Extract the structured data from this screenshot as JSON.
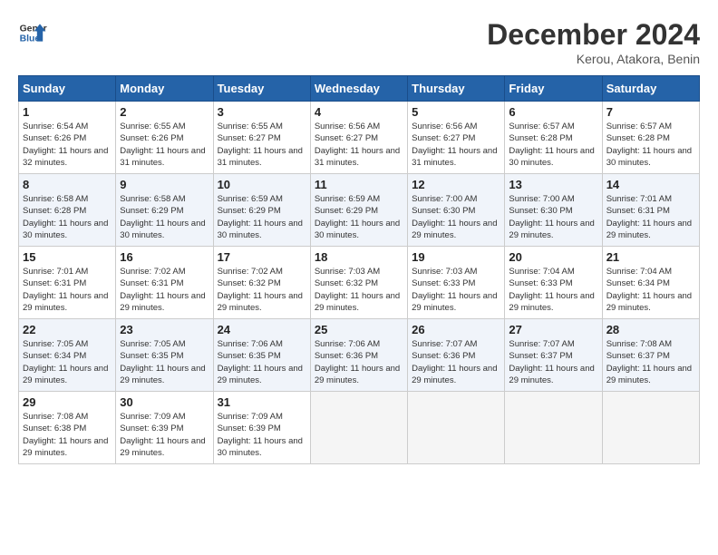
{
  "logo": {
    "line1": "General",
    "line2": "Blue"
  },
  "title": "December 2024",
  "location": "Kerou, Atakora, Benin",
  "days_of_week": [
    "Sunday",
    "Monday",
    "Tuesday",
    "Wednesday",
    "Thursday",
    "Friday",
    "Saturday"
  ],
  "weeks": [
    [
      {
        "day": "1",
        "rise": "6:54 AM",
        "set": "6:26 PM",
        "daylight": "11 hours and 32 minutes."
      },
      {
        "day": "2",
        "rise": "6:55 AM",
        "set": "6:26 PM",
        "daylight": "11 hours and 31 minutes."
      },
      {
        "day": "3",
        "rise": "6:55 AM",
        "set": "6:27 PM",
        "daylight": "11 hours and 31 minutes."
      },
      {
        "day": "4",
        "rise": "6:56 AM",
        "set": "6:27 PM",
        "daylight": "11 hours and 31 minutes."
      },
      {
        "day": "5",
        "rise": "6:56 AM",
        "set": "6:27 PM",
        "daylight": "11 hours and 31 minutes."
      },
      {
        "day": "6",
        "rise": "6:57 AM",
        "set": "6:28 PM",
        "daylight": "11 hours and 30 minutes."
      },
      {
        "day": "7",
        "rise": "6:57 AM",
        "set": "6:28 PM",
        "daylight": "11 hours and 30 minutes."
      }
    ],
    [
      {
        "day": "8",
        "rise": "6:58 AM",
        "set": "6:28 PM",
        "daylight": "11 hours and 30 minutes."
      },
      {
        "day": "9",
        "rise": "6:58 AM",
        "set": "6:29 PM",
        "daylight": "11 hours and 30 minutes."
      },
      {
        "day": "10",
        "rise": "6:59 AM",
        "set": "6:29 PM",
        "daylight": "11 hours and 30 minutes."
      },
      {
        "day": "11",
        "rise": "6:59 AM",
        "set": "6:29 PM",
        "daylight": "11 hours and 30 minutes."
      },
      {
        "day": "12",
        "rise": "7:00 AM",
        "set": "6:30 PM",
        "daylight": "11 hours and 29 minutes."
      },
      {
        "day": "13",
        "rise": "7:00 AM",
        "set": "6:30 PM",
        "daylight": "11 hours and 29 minutes."
      },
      {
        "day": "14",
        "rise": "7:01 AM",
        "set": "6:31 PM",
        "daylight": "11 hours and 29 minutes."
      }
    ],
    [
      {
        "day": "15",
        "rise": "7:01 AM",
        "set": "6:31 PM",
        "daylight": "11 hours and 29 minutes."
      },
      {
        "day": "16",
        "rise": "7:02 AM",
        "set": "6:31 PM",
        "daylight": "11 hours and 29 minutes."
      },
      {
        "day": "17",
        "rise": "7:02 AM",
        "set": "6:32 PM",
        "daylight": "11 hours and 29 minutes."
      },
      {
        "day": "18",
        "rise": "7:03 AM",
        "set": "6:32 PM",
        "daylight": "11 hours and 29 minutes."
      },
      {
        "day": "19",
        "rise": "7:03 AM",
        "set": "6:33 PM",
        "daylight": "11 hours and 29 minutes."
      },
      {
        "day": "20",
        "rise": "7:04 AM",
        "set": "6:33 PM",
        "daylight": "11 hours and 29 minutes."
      },
      {
        "day": "21",
        "rise": "7:04 AM",
        "set": "6:34 PM",
        "daylight": "11 hours and 29 minutes."
      }
    ],
    [
      {
        "day": "22",
        "rise": "7:05 AM",
        "set": "6:34 PM",
        "daylight": "11 hours and 29 minutes."
      },
      {
        "day": "23",
        "rise": "7:05 AM",
        "set": "6:35 PM",
        "daylight": "11 hours and 29 minutes."
      },
      {
        "day": "24",
        "rise": "7:06 AM",
        "set": "6:35 PM",
        "daylight": "11 hours and 29 minutes."
      },
      {
        "day": "25",
        "rise": "7:06 AM",
        "set": "6:36 PM",
        "daylight": "11 hours and 29 minutes."
      },
      {
        "day": "26",
        "rise": "7:07 AM",
        "set": "6:36 PM",
        "daylight": "11 hours and 29 minutes."
      },
      {
        "day": "27",
        "rise": "7:07 AM",
        "set": "6:37 PM",
        "daylight": "11 hours and 29 minutes."
      },
      {
        "day": "28",
        "rise": "7:08 AM",
        "set": "6:37 PM",
        "daylight": "11 hours and 29 minutes."
      }
    ],
    [
      {
        "day": "29",
        "rise": "7:08 AM",
        "set": "6:38 PM",
        "daylight": "11 hours and 29 minutes."
      },
      {
        "day": "30",
        "rise": "7:09 AM",
        "set": "6:39 PM",
        "daylight": "11 hours and 29 minutes."
      },
      {
        "day": "31",
        "rise": "7:09 AM",
        "set": "6:39 PM",
        "daylight": "11 hours and 30 minutes."
      },
      null,
      null,
      null,
      null
    ]
  ]
}
